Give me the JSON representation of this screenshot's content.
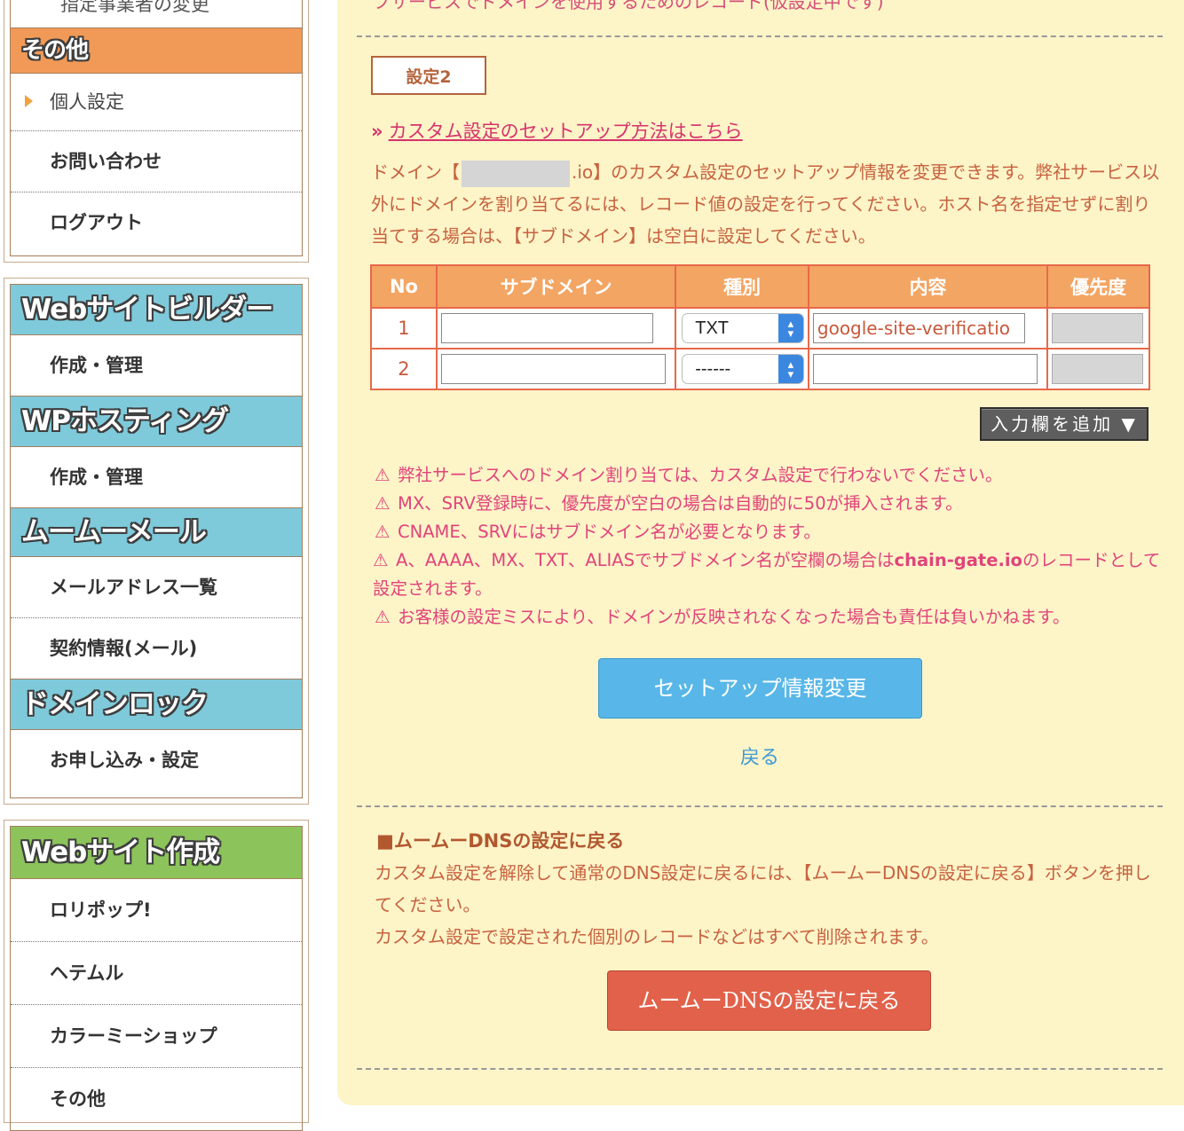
{
  "sidebar": {
    "top_cut_item": "指定事業者の変更",
    "other": {
      "title": "その他",
      "items": [
        "個人設定",
        "お問い合わせ",
        "ログアウト"
      ]
    },
    "builder": {
      "title": "Webサイトビルダー",
      "items": [
        "作成・管理"
      ]
    },
    "wp": {
      "title": "WPホスティング",
      "items": [
        "作成・管理"
      ]
    },
    "mail": {
      "title": "ムームーメール",
      "items": [
        "メールアドレス一覧",
        "契約情報(メール)"
      ]
    },
    "lock": {
      "title": "ドメインロック",
      "items": [
        "お申し込み・設定"
      ]
    },
    "web": {
      "title": "Webサイト作成",
      "items": [
        "ロリポップ!",
        "ヘテムル",
        "カラーミーショップ",
        "その他"
      ]
    }
  },
  "main": {
    "cut_text": "ブサービスでドメインを使用するためのレコード(仮設定中です)",
    "setting_tag": "設定2",
    "setup_link": "カスタム設定のセットアップ方法はこちら",
    "desc": {
      "before_domain": "ドメイン【",
      "domain_suffix": ".io】",
      "after_domain": "のカスタム設定のセットアップ情報を変更できます。弊社サービス以外にドメインを割り当てるには、レコード値の設定を行ってください。ホスト名を指定せずに割り当てする場合は、【サブドメイン】は空白に設定してください。"
    },
    "table": {
      "headers": [
        "No",
        "サブドメイン",
        "種別",
        "内容",
        "優先度"
      ],
      "rows": [
        {
          "no": "1",
          "subdomain": "",
          "type": "TXT",
          "content": "google-site-verificatio",
          "priority": ""
        },
        {
          "no": "2",
          "subdomain": "",
          "type": "------",
          "content": "",
          "priority": ""
        }
      ]
    },
    "add_button": "入力欄を追加",
    "warnings": [
      "弊社サービスへのドメイン割り当ては、カスタム設定で行わないでください。",
      "MX、SRV登録時に、優先度が空白の場合は自動的に50が挿入されます。",
      "CNAME、SRVにはサブドメイン名が必要となります。",
      "A、AAAA、MX、TXT、ALIASでサブドメイン名が空欄の場合は",
      "chain-gate.io",
      "のレコードとして設定されます。",
      "お客様の設定ミスにより、ドメインが反映されなくなった場合も責任は負いかねます。"
    ],
    "submit_button": "セットアップ情報変更",
    "back_link": "戻る",
    "dns_section": {
      "heading": "■ムームーDNSの設定に戻る",
      "line1": "カスタム設定を解除して通常のDNS設定に戻るには、【ムームーDNSの設定に戻る】ボタンを押してください。",
      "line2": "カスタム設定で設定された個別のレコードなどはすべて削除されます。",
      "button": "ムームーDNSの設定に戻る"
    }
  }
}
